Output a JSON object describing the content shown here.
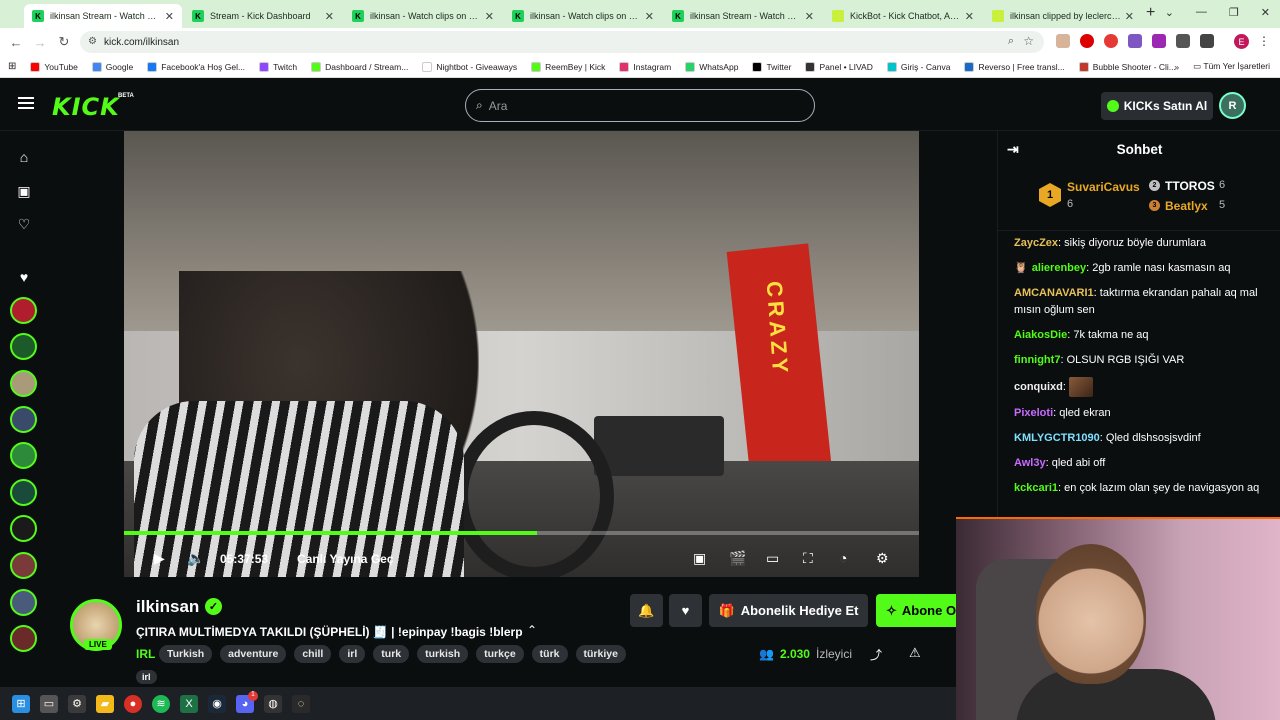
{
  "browser": {
    "tabs": [
      {
        "title": "ilkinsan Stream - Watch Live on",
        "active": true,
        "fav": "K"
      },
      {
        "title": "Stream - Kick Dashboard",
        "active": false,
        "fav": "K"
      },
      {
        "title": "ilkinsan - Watch clips on Kick",
        "active": false,
        "fav": "K"
      },
      {
        "title": "ilkinsan - Watch clips on Kick",
        "active": false,
        "fav": "K"
      },
      {
        "title": "ilkinsan Stream - Watch Live on",
        "active": false,
        "fav": "K"
      },
      {
        "title": "KickBot - Kick Chatbot, Alerts,",
        "active": false,
        "fav": ""
      },
      {
        "title": "ilkinsan clipped by leclercurry",
        "active": false,
        "fav": ""
      }
    ],
    "new_tab": "+",
    "url": "kick.com/ilkinsan",
    "bookmarks": [
      {
        "label": "YouTube",
        "color": "#ff0000"
      },
      {
        "label": "Google",
        "color": "#4285f4"
      },
      {
        "label": "Facebook'a Hoş Gel...",
        "color": "#1877f2"
      },
      {
        "label": "Twitch",
        "color": "#9146ff"
      },
      {
        "label": "Dashboard / Stream...",
        "color": "#53fc18"
      },
      {
        "label": "Nightbot - Giveaways",
        "color": "#ffffff"
      },
      {
        "label": "ReemBey | Kick",
        "color": "#53fc18"
      },
      {
        "label": "Instagram",
        "color": "#e1306c"
      },
      {
        "label": "WhatsApp",
        "color": "#25d366"
      },
      {
        "label": "Twitter",
        "color": "#000000"
      },
      {
        "label": "Panel • LIVAD",
        "color": "#333333"
      },
      {
        "label": "Giriş - Canva",
        "color": "#00c4cc"
      },
      {
        "label": "Reverso | Free transl...",
        "color": "#1b6ac9"
      },
      {
        "label": "Bubble Shooter - Cli...",
        "color": "#c0392b"
      }
    ],
    "bookmarks_more": "»",
    "all_bookmarks": "Tüm Yer İşaretleri",
    "profile_initial": "E"
  },
  "kick": {
    "logo": "KICK",
    "beta": "BETA",
    "search_placeholder": "Ara",
    "buy_kicks": "KICKs Satın Al",
    "avatar_initial": "R",
    "accent": "#53fc18"
  },
  "player": {
    "time": "05:37:53",
    "go_live": "Canlı Yayına Geç",
    "progress": 0.52,
    "crazy_sign": "CRAZY"
  },
  "stream": {
    "name": "ilkinsan",
    "live": "LIVE",
    "title": "ÇITIRA MULTİMEDYA TAKILDI (ŞÜPHELİ) 🧾 | !epinpay !bagis !blerp",
    "category": "IRL",
    "tags": [
      "Turkish",
      "adventure",
      "chill",
      "irl",
      "turk",
      "turkish",
      "turkçe",
      "türk",
      "türkiye"
    ],
    "tags_row2": [
      "irl"
    ],
    "gift_sub": "Abonelik Hediye Et",
    "subscribe": "Abone Ol",
    "viewers": "2.030",
    "viewers_label": "İzleyici"
  },
  "chat": {
    "title": "Sohbet",
    "leaders": [
      {
        "rank": "1",
        "name": "SuvariCavus",
        "count": "6",
        "color": "#e8a825"
      },
      {
        "rank": "2",
        "name": "TTOROS",
        "count": "6",
        "color": "#c0c0c0"
      },
      {
        "rank": "3",
        "name": "Beatlyx",
        "count": "5",
        "color": "#cd7f32"
      }
    ],
    "messages": [
      {
        "user": "ZaycZex",
        "color": "#e6c15a",
        "text": "sikiş diyoruz böyle durumlara"
      },
      {
        "user": "alierenbey",
        "color": "#53fc18",
        "text": "2gb ramle nası kasmasın aq",
        "badge": "🦉"
      },
      {
        "user": "AMCANAVARI1",
        "color": "#e6c15a",
        "text": "taktırma ekrandan pahalı aq mal mısın oğlum sen"
      },
      {
        "user": "AiakosDie",
        "color": "#53fc18",
        "text": "7k takma ne aq"
      },
      {
        "user": "finnight7",
        "color": "#53fc18",
        "text": "OLSUN RGB IŞIĞI VAR"
      },
      {
        "user": "conquixd",
        "color": "#f0f0f0",
        "text": "",
        "emote": true
      },
      {
        "user": "Pixeloti",
        "color": "#c86bff",
        "text": "qled ekran"
      },
      {
        "user": "KMLYGCTR1090",
        "color": "#7ee0ff",
        "text": "Qled dlshsosjsvdinf"
      },
      {
        "user": "Awl3y",
        "color": "#c86bff",
        "text": "qled abi off"
      },
      {
        "user": "kckcari1",
        "color": "#53fc18",
        "text": "en çok lazım olan şey de navigasyon aq"
      }
    ]
  },
  "taskbar": {
    "icons": [
      "windows-icon",
      "taskview-icon",
      "settings-icon",
      "explorer-icon",
      "chrome-icon",
      "spotify-icon",
      "excel-icon",
      "steam-icon",
      "discord-icon",
      "obs-icon",
      "git-icon"
    ],
    "discord_badge": "1"
  }
}
